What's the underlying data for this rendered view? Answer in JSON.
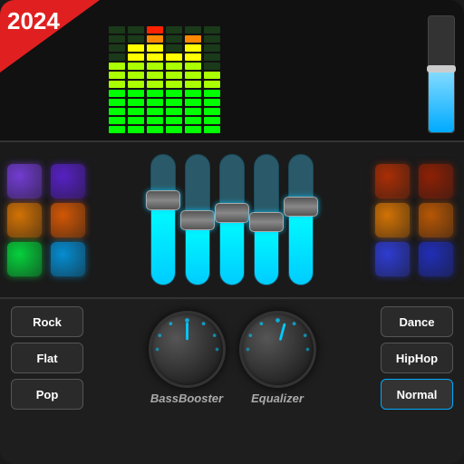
{
  "badge": {
    "year": "2024"
  },
  "eqBars": [
    {
      "heights": [
        8,
        7,
        6,
        5,
        4,
        3,
        2,
        1
      ],
      "colors": [
        "#ff0000",
        "#ff4400",
        "#ffaa00",
        "#ffff00",
        "#00ff00",
        "#00ff00",
        "#00ff00",
        "#00ff00"
      ]
    },
    {
      "heights": [
        10,
        9,
        8,
        7,
        6,
        5,
        4,
        3
      ],
      "colors": [
        "#ff0000",
        "#ff0000",
        "#ff4400",
        "#ffaa00",
        "#ffff00",
        "#00ff00",
        "#00ff00",
        "#00ff00"
      ]
    },
    {
      "heights": [
        12,
        11,
        10,
        9,
        8,
        7,
        6,
        5
      ],
      "colors": [
        "#ff0000",
        "#ff0000",
        "#ff0000",
        "#ff4400",
        "#ffaa00",
        "#ffff00",
        "#00ff00",
        "#00ff00"
      ]
    },
    {
      "heights": [
        9,
        8,
        7,
        6,
        5,
        4,
        3,
        2
      ],
      "colors": [
        "#ff0000",
        "#ff4400",
        "#ffaa00",
        "#ffff00",
        "#00ff00",
        "#00ff00",
        "#00ff00",
        "#00ff00"
      ]
    },
    {
      "heights": [
        11,
        10,
        9,
        8,
        7,
        6,
        5,
        4
      ],
      "colors": [
        "#ff0000",
        "#ff0000",
        "#ff4400",
        "#ffaa00",
        "#ffff00",
        "#00ff00",
        "#00ff00",
        "#00ff00"
      ]
    },
    {
      "heights": [
        7,
        6,
        5,
        4,
        3,
        2,
        1,
        1
      ],
      "colors": [
        "#ff4400",
        "#ffaa00",
        "#ffff00",
        "#00ff00",
        "#00ff00",
        "#00ff00",
        "#00ff00",
        "#00ff00"
      ]
    }
  ],
  "rightSlider": {
    "fillPercent": 55
  },
  "leftPads": [
    {
      "color": "#8844ff"
    },
    {
      "color": "#6622ee"
    },
    {
      "color": "#ff8800"
    },
    {
      "color": "#ff6600"
    },
    {
      "color": "#00ff44"
    },
    {
      "color": "#00aaff"
    }
  ],
  "rightPads": [
    {
      "color": "#cc3300"
    },
    {
      "color": "#aa2200"
    },
    {
      "color": "#ff8800"
    },
    {
      "color": "#dd6600"
    },
    {
      "color": "#3344ff"
    },
    {
      "color": "#2233dd"
    }
  ],
  "faders": [
    {
      "fillPercent": 65,
      "handlePos": 38
    },
    {
      "fillPercent": 50,
      "handlePos": 52
    },
    {
      "fillPercent": 55,
      "handlePos": 47
    },
    {
      "fillPercent": 48,
      "handlePos": 54
    },
    {
      "fillPercent": 60,
      "handlePos": 42
    }
  ],
  "knobs": [
    {
      "label": "BassBooster",
      "rotation": -20
    },
    {
      "label": "Equalizer",
      "rotation": 15
    }
  ],
  "leftPresets": [
    {
      "label": "Rock",
      "active": false
    },
    {
      "label": "Flat",
      "active": false
    },
    {
      "label": "Pop",
      "active": false
    }
  ],
  "rightPresets": [
    {
      "label": "Dance",
      "active": false
    },
    {
      "label": "HipHop",
      "active": false
    },
    {
      "label": "Normal",
      "active": true
    }
  ]
}
